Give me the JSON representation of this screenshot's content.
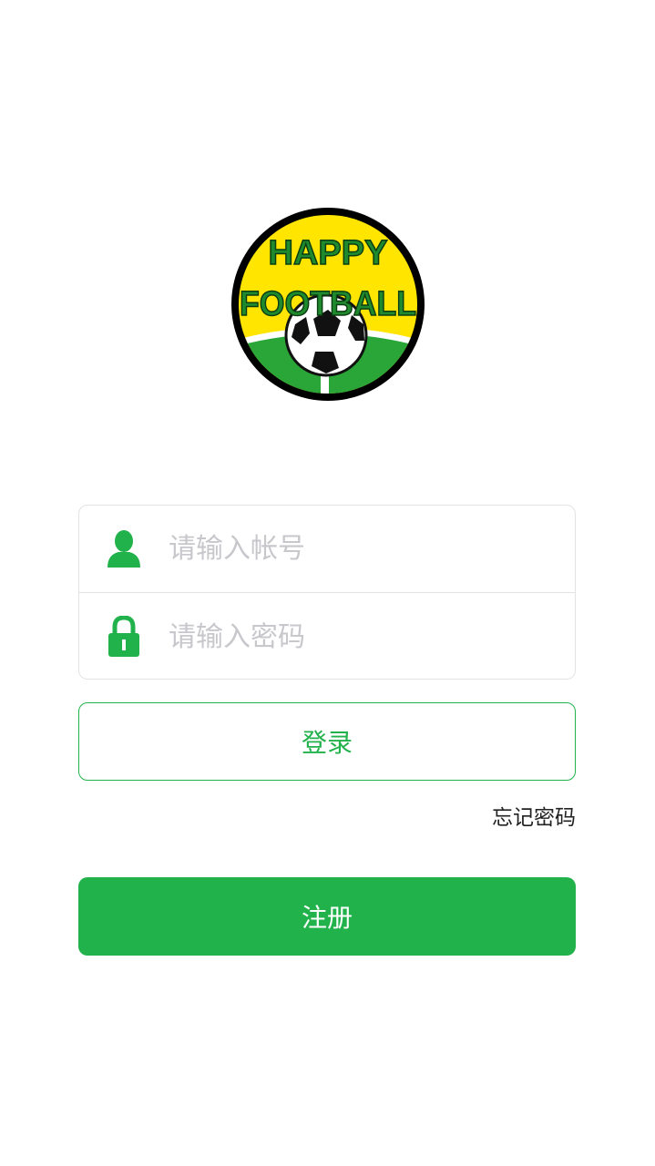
{
  "logo": {
    "line1": "HAPPY",
    "line2": "FOOTBALL",
    "colors": {
      "ring": "#000000",
      "sky": "#ffe500",
      "grass": "#2aa639",
      "text": "#1f8a2d"
    }
  },
  "form": {
    "account": {
      "placeholder": "请输入帐号",
      "value": "",
      "icon": "user-icon"
    },
    "password": {
      "placeholder": "请输入密码",
      "value": "",
      "icon": "lock-icon"
    }
  },
  "buttons": {
    "login_label": "登录",
    "register_label": "注册",
    "forgot_label": "忘记密码"
  },
  "colors": {
    "accent": "#22b24c",
    "border": "#e3e3e3",
    "placeholder": "#c7c7cc"
  }
}
